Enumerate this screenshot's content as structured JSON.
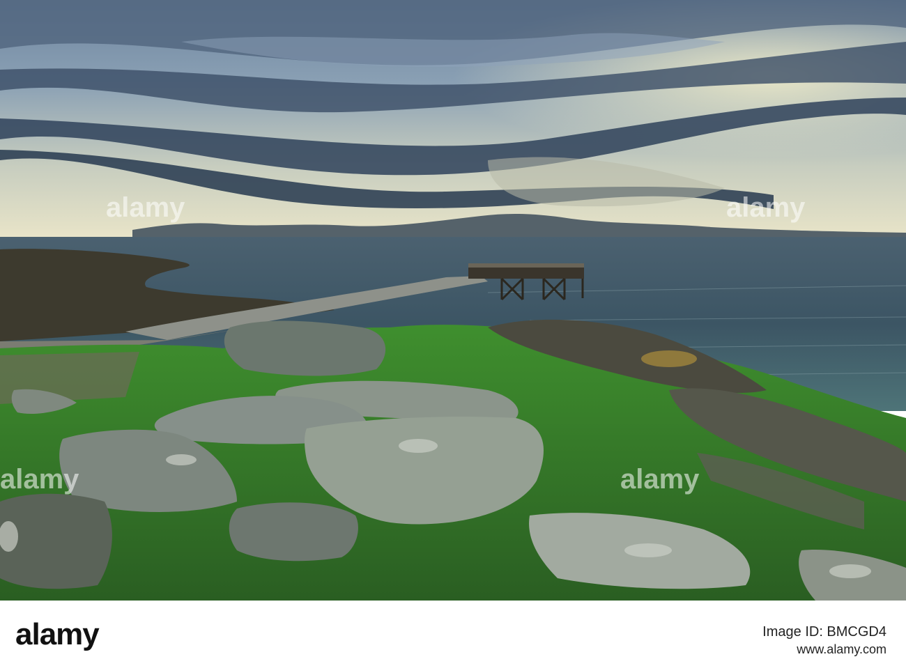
{
  "watermark": {
    "text": "alamy"
  },
  "footer": {
    "brand": "alamy",
    "image_id": "Image ID: BMCGD4",
    "url": "www.alamy.com"
  },
  "colors": {
    "sky_top": "#5d7590",
    "sky_light": "#d9dfcf",
    "cloud_dark": "#2d3f55",
    "sea": "#3d5665",
    "grass": "#3a8f2a",
    "rock": "#7f8a80"
  }
}
